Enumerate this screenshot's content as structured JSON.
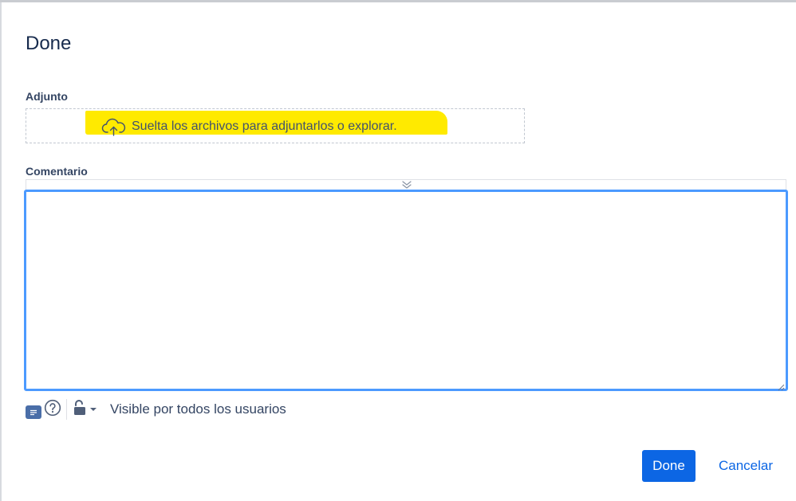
{
  "dialog": {
    "title": "Done"
  },
  "attachment": {
    "label": "Adjunto",
    "dropzone_text": "Suelta los archivos para adjuntarlos o explorar.",
    "highlight_color": "#ffea00",
    "icon": "cloud-upload-icon"
  },
  "comment": {
    "label": "Comentario",
    "value": "",
    "focus_color": "#4c9aff"
  },
  "comment_footer": {
    "visibility_text": "Visible por todos los usuarios",
    "icons": [
      "wiki-markup-icon",
      "help-icon",
      "lock-icon",
      "chevron-down-icon"
    ]
  },
  "actions": {
    "done_label": "Done",
    "cancel_label": "Cancelar",
    "primary_color": "#0c66e4"
  }
}
